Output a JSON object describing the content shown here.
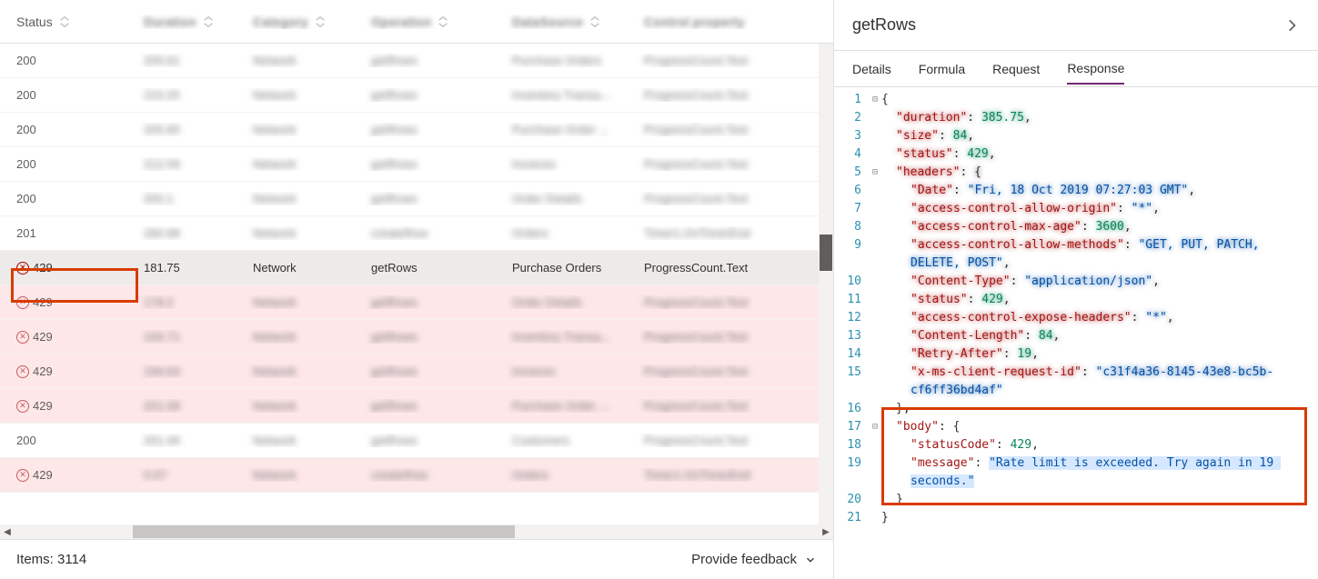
{
  "grid": {
    "columns": {
      "status": "Status",
      "duration": "Duration",
      "category": "Category",
      "operation": "Operation",
      "datasource": "DataSource",
      "control": "Control property"
    },
    "rows": [
      {
        "status": "200",
        "duration": "205.61",
        "category": "Network",
        "operation": "getRows",
        "datasource": "Purchase Orders",
        "control": "ProgressCount.Text",
        "error": false,
        "blurred": true
      },
      {
        "status": "200",
        "duration": "215.25",
        "category": "Network",
        "operation": "getRows",
        "datasource": "Inventory Transa...",
        "control": "ProgressCount.Text",
        "error": false,
        "blurred": true
      },
      {
        "status": "200",
        "duration": "205.95",
        "category": "Network",
        "operation": "getRows",
        "datasource": "Purchase Order ...",
        "control": "ProgressCount.Text",
        "error": false,
        "blurred": true
      },
      {
        "status": "200",
        "duration": "212.59",
        "category": "Network",
        "operation": "getRows",
        "datasource": "Invoices",
        "control": "ProgressCount.Text",
        "error": false,
        "blurred": true
      },
      {
        "status": "200",
        "duration": "200.1",
        "category": "Network",
        "operation": "getRows",
        "datasource": "Order Details",
        "control": "ProgressCount.Text",
        "error": false,
        "blurred": true
      },
      {
        "status": "201",
        "duration": "260.98",
        "category": "Network",
        "operation": "createRow",
        "datasource": "Orders",
        "control": "Timer1.OnTimerEnd",
        "error": false,
        "blurred": true
      },
      {
        "status": "429",
        "duration": "181.75",
        "category": "Network",
        "operation": "getRows",
        "datasource": "Purchase Orders",
        "control": "ProgressCount.Text",
        "error": true,
        "blurred": false,
        "selected": true
      },
      {
        "status": "429",
        "duration": "178.2",
        "category": "Network",
        "operation": "getRows",
        "datasource": "Order Details",
        "control": "ProgressCount.Text",
        "error": true,
        "blurred": true
      },
      {
        "status": "429",
        "duration": "194.71",
        "category": "Network",
        "operation": "getRows",
        "datasource": "Inventory Transa...",
        "control": "ProgressCount.Text",
        "error": true,
        "blurred": true
      },
      {
        "status": "429",
        "duration": "194.63",
        "category": "Network",
        "operation": "getRows",
        "datasource": "Invoices",
        "control": "ProgressCount.Text",
        "error": true,
        "blurred": true
      },
      {
        "status": "429",
        "duration": "201.08",
        "category": "Network",
        "operation": "getRows",
        "datasource": "Purchase Order ...",
        "control": "ProgressCount.Text",
        "error": true,
        "blurred": true
      },
      {
        "status": "200",
        "duration": "201.49",
        "category": "Network",
        "operation": "getRows",
        "datasource": "Customers",
        "control": "ProgressCount.Text",
        "error": false,
        "blurred": true
      },
      {
        "status": "429",
        "duration": "0.07",
        "category": "Network",
        "operation": "createRow",
        "datasource": "Orders",
        "control": "Timer1.OnTimerEnd",
        "error": true,
        "blurred": true
      }
    ],
    "footer_items": "Items: 3114",
    "footer_feedback": "Provide feedback"
  },
  "detail": {
    "title": "getRows",
    "tabs": {
      "details": "Details",
      "formula": "Formula",
      "request": "Request",
      "response": "Response"
    },
    "active_tab": "response",
    "response": {
      "duration_key": "duration",
      "duration_val": "385.75",
      "size_key": "size",
      "size_val": "84",
      "status_key": "status",
      "status_val": "429",
      "headers_key": "headers",
      "date_key": "Date",
      "date_val": "Fri, 18 Oct 2019 07:27:03 GMT",
      "ac_origin_key": "access-control-allow-origin",
      "ac_origin_val": "*",
      "ac_maxage_key": "access-control-max-age",
      "ac_maxage_val": "3600",
      "ac_methods_key": "access-control-allow-methods",
      "ac_methods_val": "GET, PUT, PATCH, DELETE, POST",
      "ctype_key": "Content-Type",
      "ctype_val": "application/json",
      "hstatus_key": "status",
      "hstatus_val": "429",
      "ac_expose_key": "access-control-expose-headers",
      "ac_expose_val": "*",
      "clen_key": "Content-Length",
      "clen_val": "84",
      "retry_key": "Retry-After",
      "retry_val": "19",
      "clientid_key": "x-ms-client-request-id",
      "clientid_val": "c31f4a36-8145-43e8-bc5b-cf6ff36bd4af",
      "body_key": "body",
      "statuscode_key": "statusCode",
      "statuscode_val": "429",
      "message_key": "message",
      "message_val": "Rate limit is exceeded. Try again in 19 seconds."
    }
  }
}
